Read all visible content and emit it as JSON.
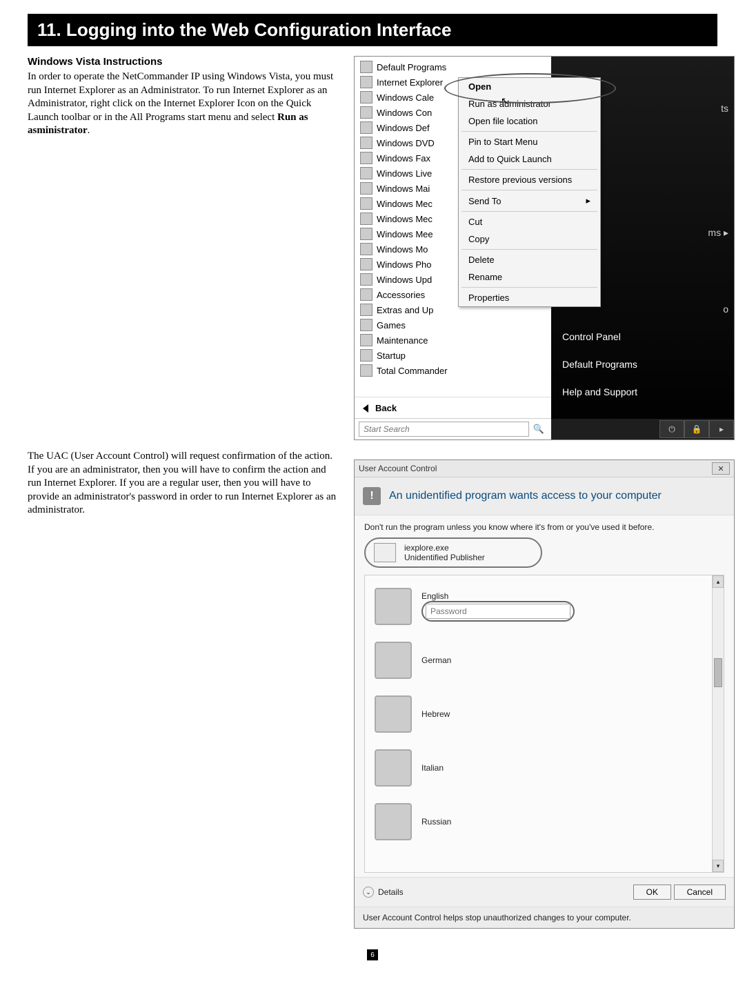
{
  "title": "11. Logging into the Web Configuration Interface",
  "section1": {
    "heading": "Windows Vista Instructions",
    "para_a": "In order to operate the NetCommander IP using Windows Vista, you must run Internet Explorer as an Administrator. To run Internet Explorer as an Administrator, right click on the Internet Explorer Icon on the Quick Launch toolbar or in the All Programs start menu and select ",
    "para_bold": "Run as asministrator",
    "para_b": "."
  },
  "section2": {
    "para": "The UAC (User Account Control) will request confirmation of the action. If you are an administrator, then you will have to confirm the action and run Internet Explorer. If you are a regular user, then you will have to provide an administrator's password in order to run Internet Explorer as an administrator."
  },
  "startmenu": {
    "programs": [
      "Default Programs",
      "Internet Explorer",
      "Windows Cale",
      "Windows Con",
      "Windows Def",
      "Windows DVD",
      "Windows Fax",
      "Windows Live",
      "Windows Mai",
      "Windows Mec",
      "Windows Mec",
      "Windows Mee",
      "Windows Mo",
      "Windows Pho",
      "Windows Upd",
      "Accessories",
      "Extras and Up",
      "Games",
      "Maintenance",
      "Startup",
      "Total Commander"
    ],
    "back": "Back",
    "search_placeholder": "Start Search",
    "right_items_top": [
      "ts",
      "ms    ▸",
      "o"
    ],
    "right_items": [
      "Control Panel",
      "Default Programs",
      "Help and Support"
    ]
  },
  "context_menu": {
    "items": [
      {
        "label": "Open",
        "bold": true
      },
      {
        "label": "Run as administrator"
      },
      {
        "label": "Open file location"
      },
      {
        "sep": true
      },
      {
        "label": "Pin to Start Menu"
      },
      {
        "label": "Add to Quick Launch"
      },
      {
        "sep": true
      },
      {
        "label": "Restore previous versions"
      },
      {
        "sep": true
      },
      {
        "label": "Send To",
        "sub": true
      },
      {
        "sep": true
      },
      {
        "label": "Cut"
      },
      {
        "label": "Copy"
      },
      {
        "sep": true
      },
      {
        "label": "Delete"
      },
      {
        "label": "Rename"
      },
      {
        "sep": true
      },
      {
        "label": "Properties"
      }
    ]
  },
  "uac": {
    "title": "User Account Control",
    "header": "An unidentified program wants access to your computer",
    "warn": "Don't run the program unless you know where it's from or you've used it before.",
    "prog_name": "iexplore.exe",
    "publisher": "Unidentified Publisher",
    "users": [
      "English",
      "German",
      "Hebrew",
      "Italian",
      "Russian"
    ],
    "password_placeholder": "Password",
    "details": "Details",
    "ok": "OK",
    "cancel": "Cancel",
    "footer": "User Account Control helps stop unauthorized changes to your computer."
  },
  "page_number": "6"
}
